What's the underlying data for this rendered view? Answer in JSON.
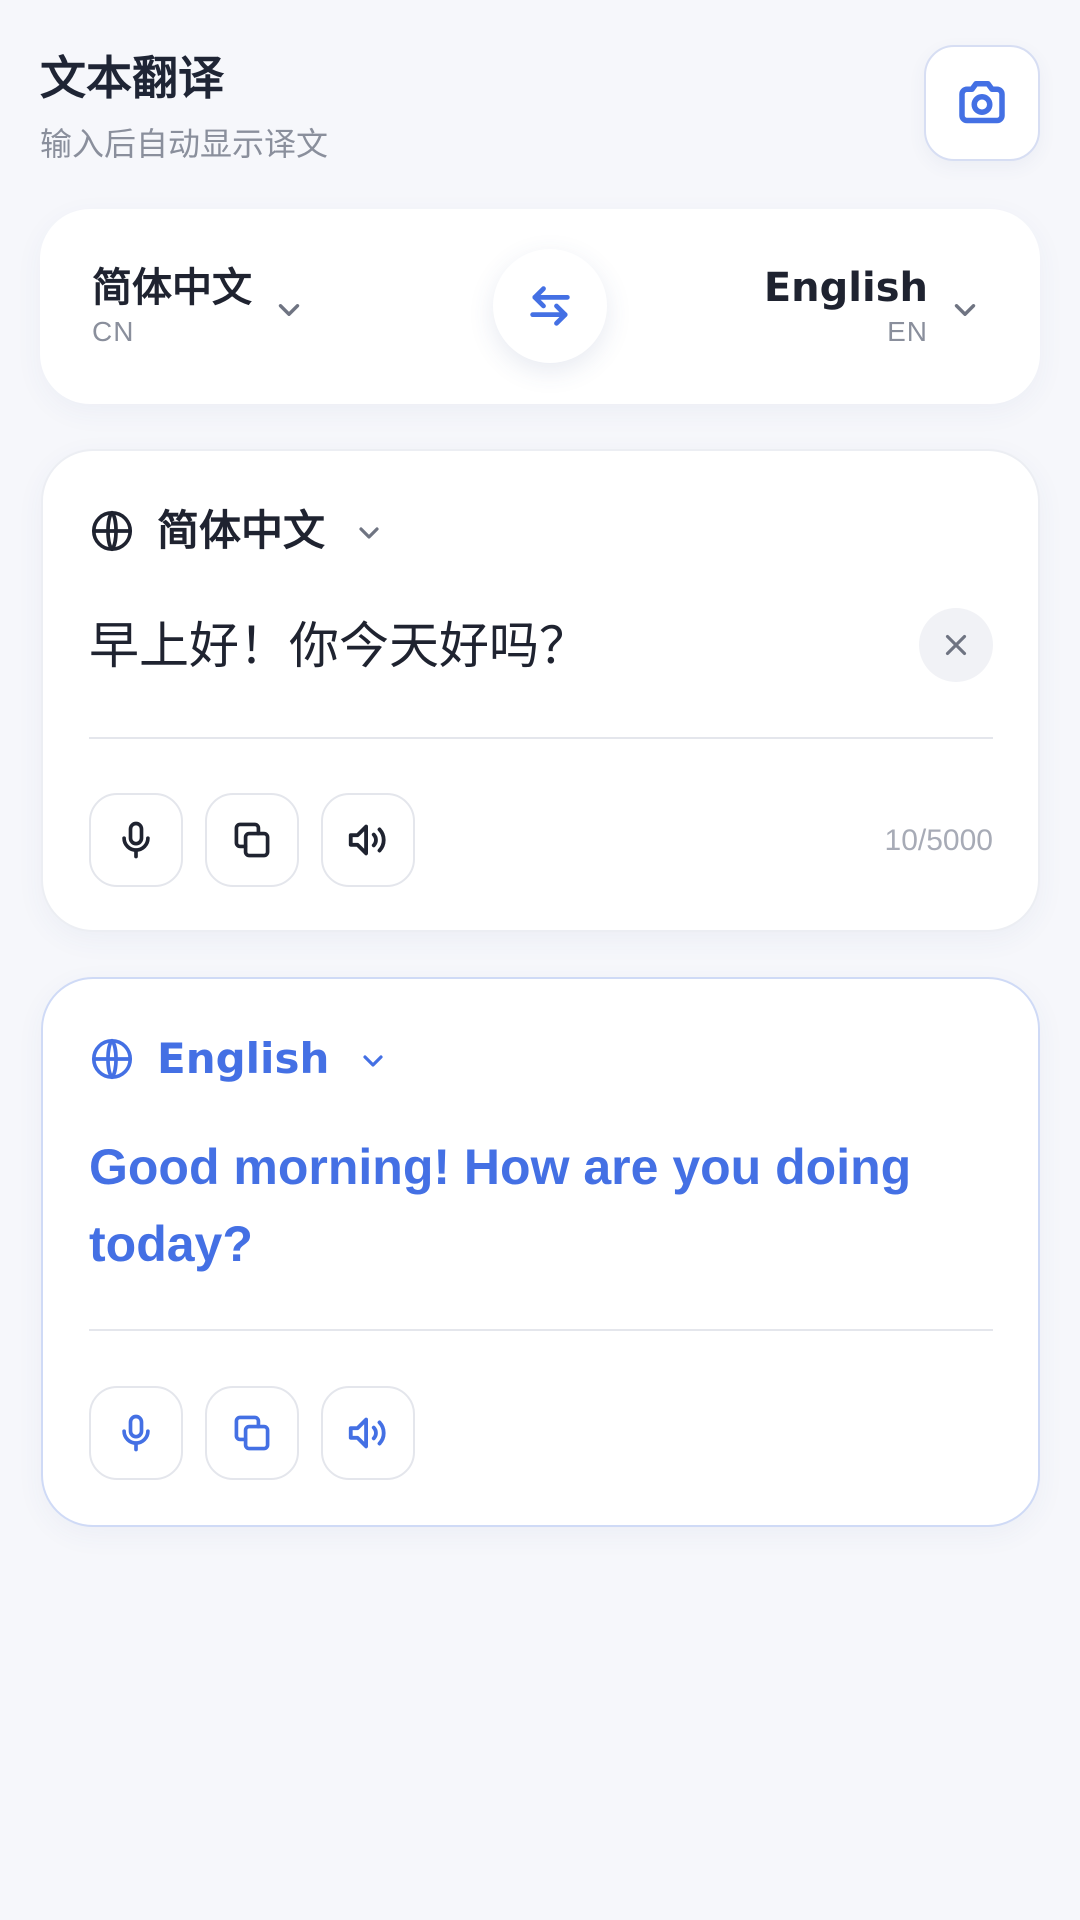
{
  "header": {
    "title": "文本翻译",
    "subtitle": "输入后自动显示译文"
  },
  "language_bar": {
    "source": {
      "name": "简体中文",
      "code": "CN"
    },
    "target": {
      "name": "English",
      "code": "EN"
    }
  },
  "source_card": {
    "language": "简体中文",
    "text": "早上好！你今天好吗？",
    "char_count": "10/5000"
  },
  "target_card": {
    "language": "English",
    "text": "Good morning! How are you doing today?"
  },
  "icons": [
    "camera-icon",
    "chevron-down-icon",
    "swap-icon",
    "globe-icon",
    "close-icon",
    "microphone-icon",
    "copy-icon",
    "speaker-icon"
  ],
  "colors": {
    "accent": "#4470e4",
    "background": "#f6f7fb",
    "card": "#ffffff",
    "muted_text": "#8a8f9c"
  }
}
